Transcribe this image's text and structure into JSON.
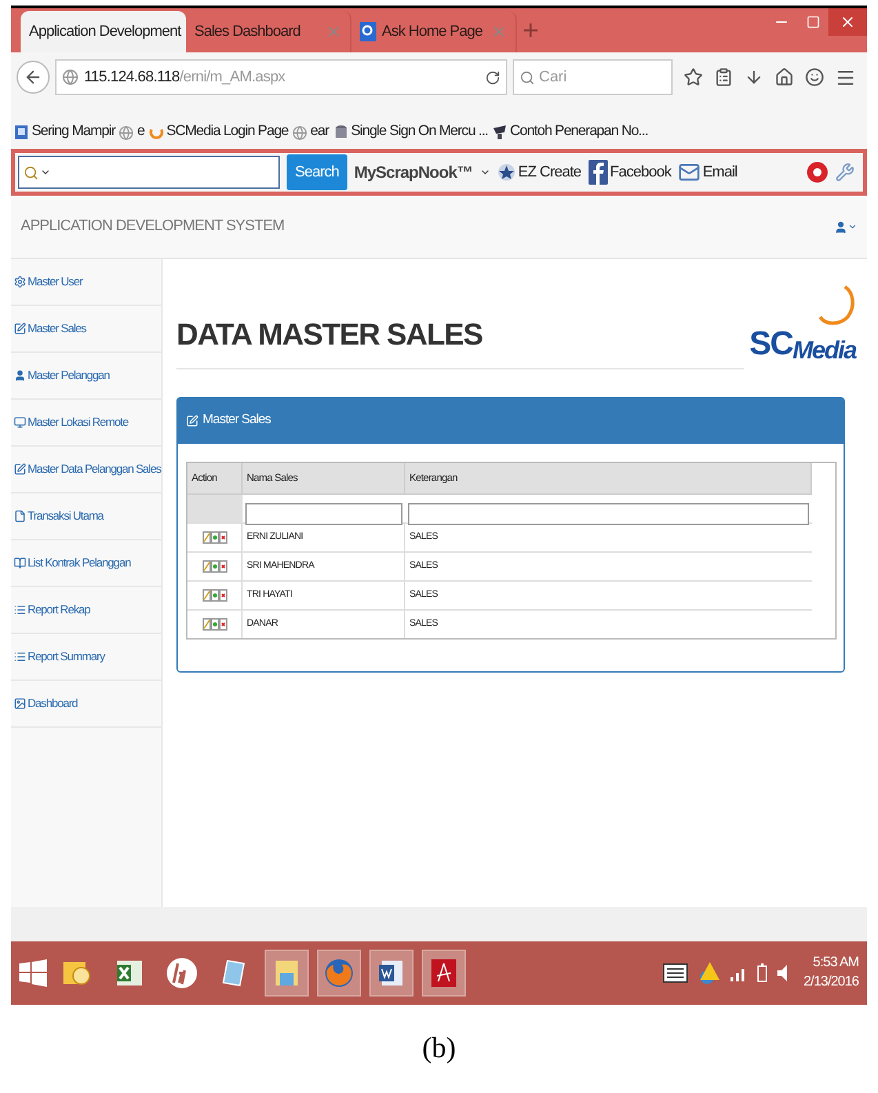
{
  "browser": {
    "tabs": [
      {
        "label": "Application Development",
        "selected": true,
        "icon": false
      },
      {
        "label": "Sales Dashboard",
        "selected": false,
        "icon": false
      },
      {
        "label": "Ask Home Page",
        "selected": false,
        "icon": true
      }
    ],
    "url_host": "115.124.68.118",
    "url_path": "/erni/m_AM.aspx",
    "search_placeholder": "Cari",
    "bookmarks": [
      {
        "label": "Sering Mampir",
        "kind": "page"
      },
      {
        "label": "e",
        "kind": "globe"
      },
      {
        "label": "SCMedia Login Page",
        "kind": "arc"
      },
      {
        "label": "ear",
        "kind": "globe"
      },
      {
        "label": "Single Sign On Mercu ...",
        "kind": "db"
      },
      {
        "label": "Contoh Penerapan No...",
        "kind": "cap"
      }
    ],
    "toolbar": {
      "search_button": "Search",
      "brand": "MyScrapNook™",
      "links": [
        {
          "label": "EZ Create",
          "kind": "star"
        },
        {
          "label": "Facebook",
          "kind": "facebook"
        },
        {
          "label": "Email",
          "kind": "mail"
        }
      ]
    }
  },
  "app": {
    "title": "APPLICATION DEVELOPMENT SYSTEM",
    "sidebar": [
      {
        "label": "Master User",
        "kind": "gear"
      },
      {
        "label": "Master Sales",
        "kind": "edit"
      },
      {
        "label": "Master Pelanggan",
        "kind": "user"
      },
      {
        "label": "Master Lokasi Remote",
        "kind": "monitor"
      },
      {
        "label": "Master Data Pelanggan Sales",
        "kind": "edit"
      },
      {
        "label": "Transaksi Utama",
        "kind": "file"
      },
      {
        "label": "List Kontrak Pelanggan",
        "kind": "book"
      },
      {
        "label": "Report Rekap",
        "kind": "list"
      },
      {
        "label": "Report Summary",
        "kind": "list"
      },
      {
        "label": "Dashboard",
        "kind": "image"
      }
    ],
    "heading": "DATA MASTER SALES",
    "logo": {
      "part_1": "SC",
      "part_2": "Media"
    },
    "panel": {
      "title": "Master Sales",
      "columns": [
        "Action",
        "Nama Sales",
        "Keterangan"
      ],
      "rows": [
        {
          "nama": "ERNI ZULIANI",
          "keterangan": "SALES"
        },
        {
          "nama": "SRI MAHENDRA",
          "keterangan": "SALES"
        },
        {
          "nama": "TRI HAYATI",
          "keterangan": "SALES"
        },
        {
          "nama": "DANAR",
          "keterangan": "SALES"
        }
      ]
    }
  },
  "taskbar": {
    "apps": [
      {
        "kind": "outlook",
        "selected": false
      },
      {
        "kind": "excel",
        "selected": false
      },
      {
        "kind": "hp",
        "selected": false
      },
      {
        "kind": "tablet",
        "selected": false
      },
      {
        "kind": "folder",
        "selected": true
      },
      {
        "kind": "firefox",
        "selected": true
      },
      {
        "kind": "word",
        "selected": true
      },
      {
        "kind": "pdf",
        "selected": true
      }
    ],
    "time": "5:53 AM",
    "date": "2/13/2016"
  },
  "caption": "(b)"
}
